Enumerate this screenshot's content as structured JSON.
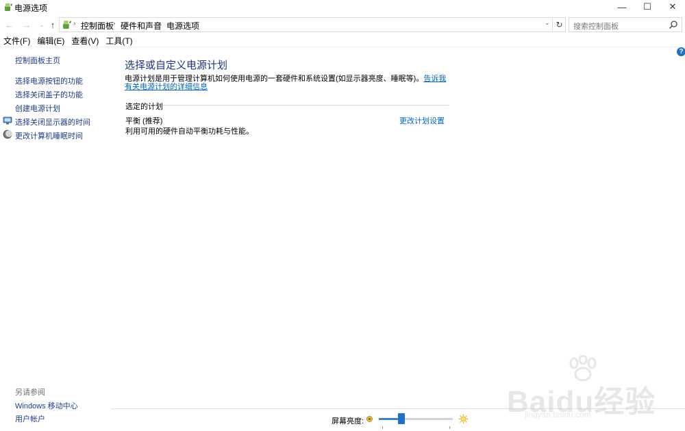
{
  "window": {
    "title": "电源选项",
    "minimize": "—",
    "maximize": "☐",
    "close": "✕"
  },
  "nav": {
    "back": "←",
    "forward": "→",
    "recent": "⌄",
    "up": "↑",
    "breadcrumbs": [
      "控制面板",
      "硬件和声音",
      "电源选项"
    ],
    "separator": "›",
    "dropdown": "⌄",
    "refresh": "↻",
    "search_placeholder": "搜索控制面板"
  },
  "menu": [
    "文件(F)",
    "编辑(E)",
    "查看(V)",
    "工具(T)"
  ],
  "help": "?",
  "sidebar": {
    "items": [
      {
        "label": "控制面板主页",
        "icon": ""
      },
      {
        "label": "选择电源按钮的功能",
        "icon": ""
      },
      {
        "label": "选择关闭盖子的功能",
        "icon": ""
      },
      {
        "label": "创建电源计划",
        "icon": ""
      },
      {
        "label": "选择关闭显示器的时间",
        "icon": "monitor-icon"
      },
      {
        "label": "更改计算机睡眠时间",
        "icon": "moon-icon"
      }
    ],
    "see_also": "另请参阅",
    "see_also_links": [
      "Windows 移动中心",
      "用户帐户"
    ]
  },
  "main": {
    "title": "选择或自定义电源计划",
    "description": "电源计划是用于管理计算机如何使用电源的一套硬件和系统设置(如显示器亮度、睡眠等)。",
    "description_link": "告诉我有关电源计划的详细信息",
    "section_label": "选定的计划",
    "plan": {
      "name": "平衡 (推荐)",
      "description": "利用可用的硬件自动平衡功耗与性能。",
      "change_link": "更改计划设置"
    }
  },
  "bottom": {
    "brightness_label": "屏幕亮度:",
    "brightness_level": 0.31
  },
  "watermark": {
    "text": "Baidu经验",
    "sub": "jingyan.baidu.com"
  },
  "colors": {
    "link": "#1d3b8f",
    "title": "#1e3287",
    "accent": "#1e6fd0"
  }
}
